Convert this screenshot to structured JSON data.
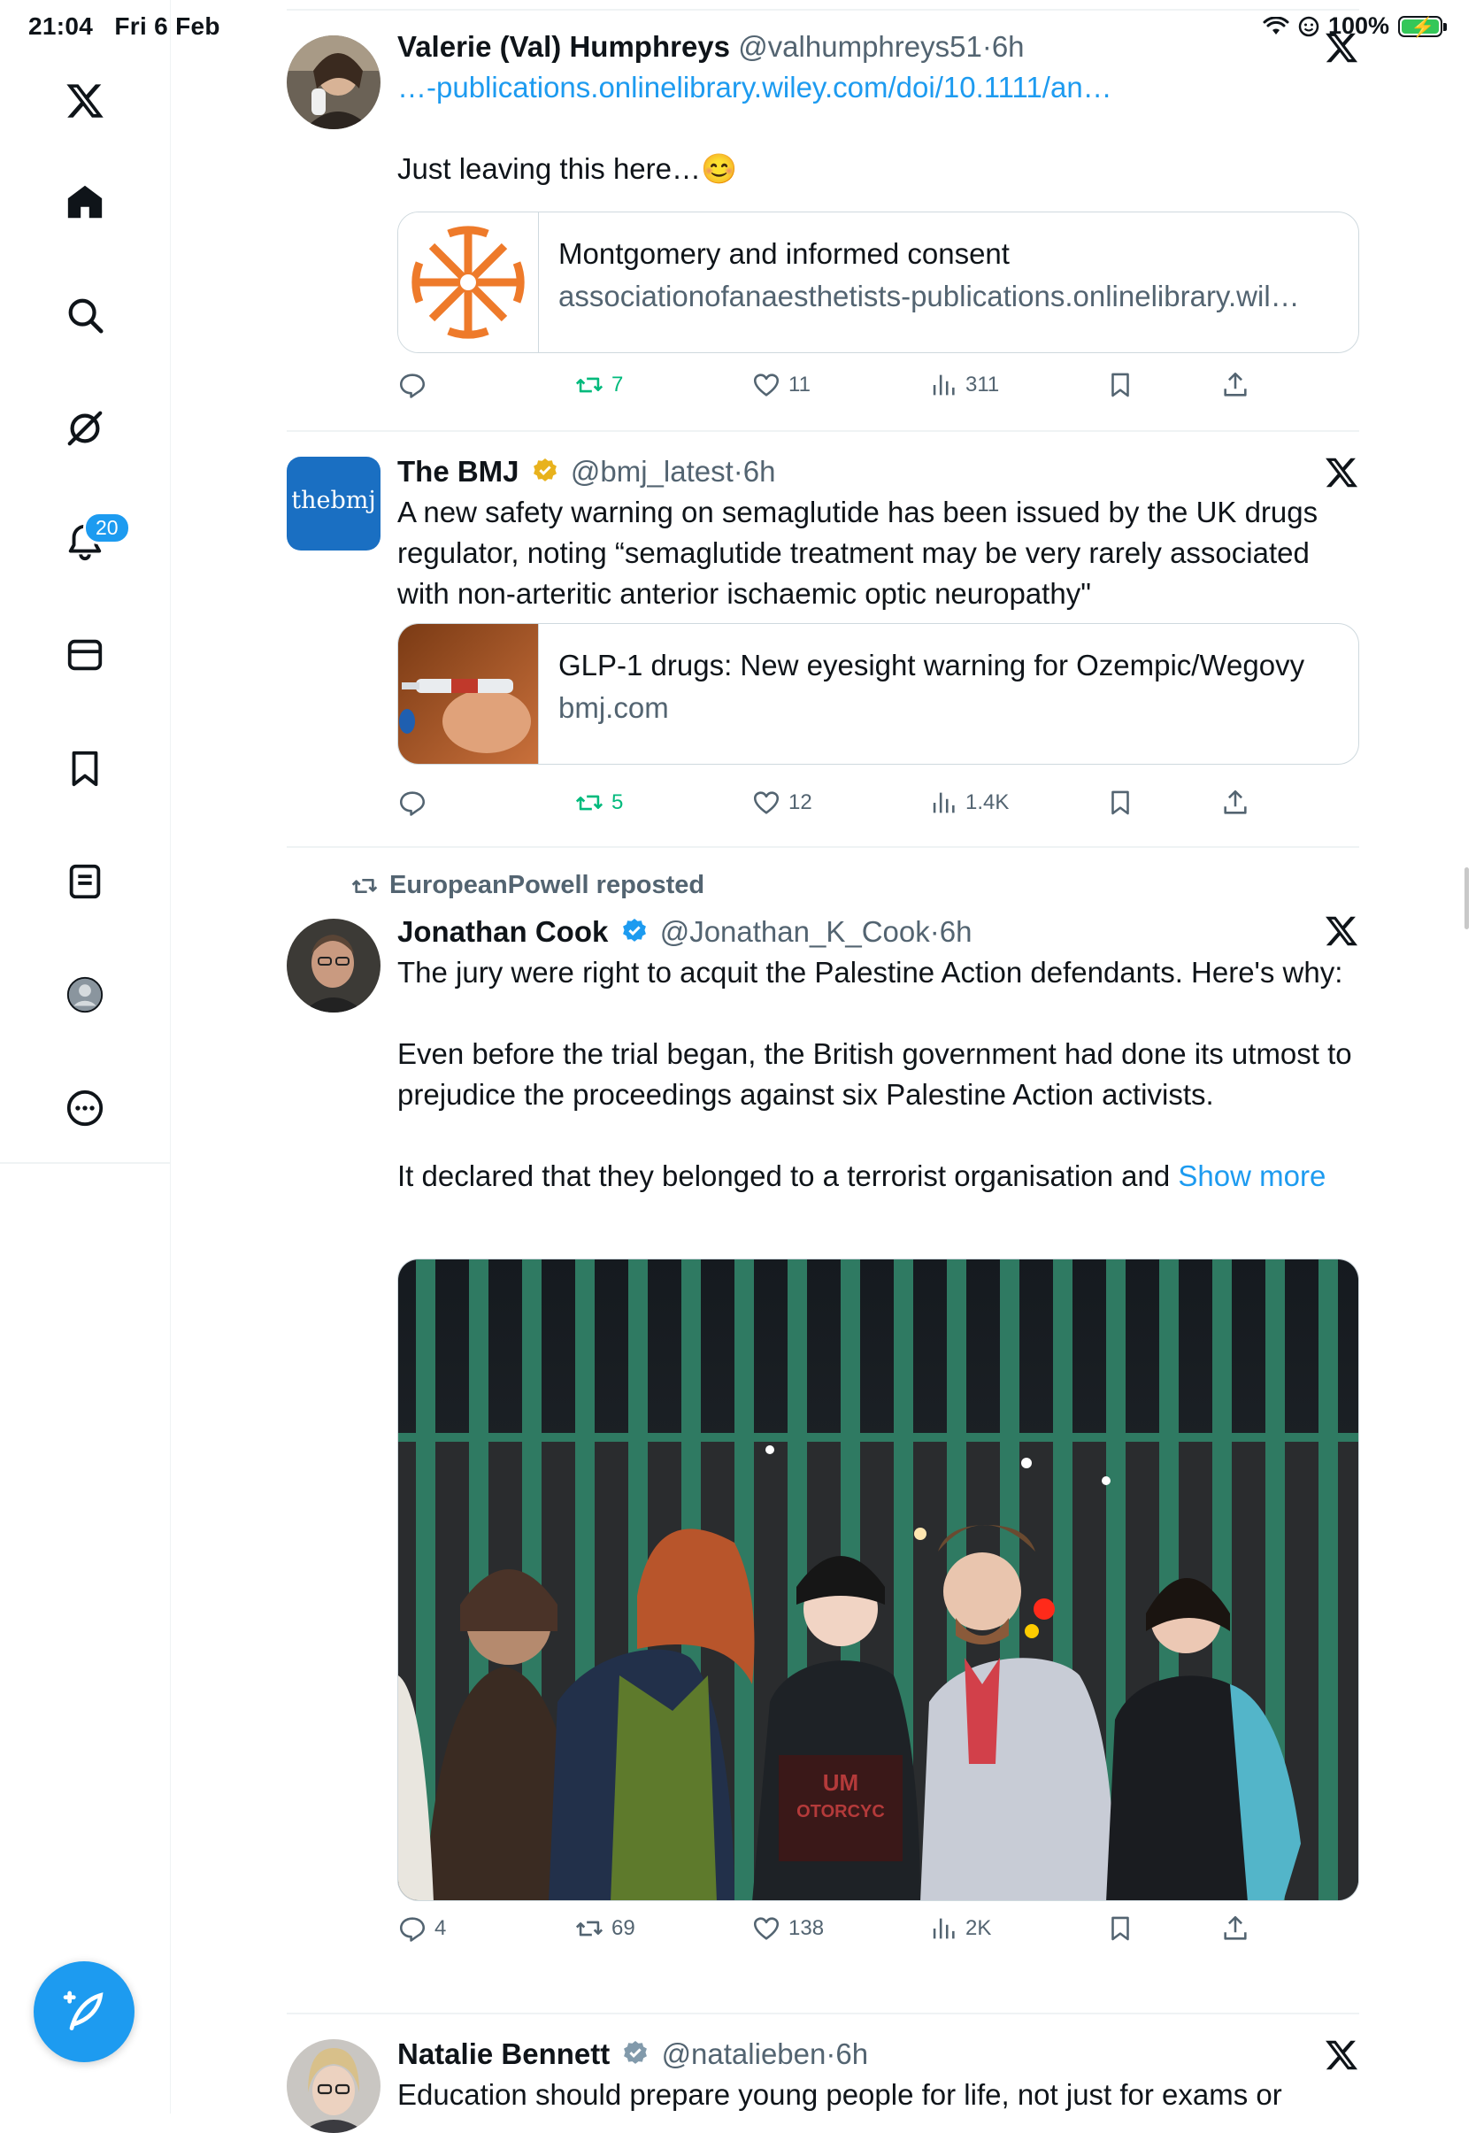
{
  "status_bar": {
    "time": "21:04",
    "date": "Fri 6 Feb",
    "battery": "100%"
  },
  "sidebar": {
    "items": [
      {
        "name": "x-logo-icon"
      },
      {
        "name": "home-icon"
      },
      {
        "name": "search-icon"
      },
      {
        "name": "grok-icon"
      },
      {
        "name": "notifications-icon",
        "badge": "20"
      },
      {
        "name": "messages-icon"
      },
      {
        "name": "bookmarks-icon"
      },
      {
        "name": "lists-icon"
      },
      {
        "name": "profile-icon"
      },
      {
        "name": "more-icon"
      }
    ],
    "compose": "compose-post-icon"
  },
  "tweets": [
    {
      "display_name": "Valerie (Val) Humphreys",
      "handle": "@valhumphreys51",
      "time": "6h",
      "link_text": "…-publications.onlinelibrary.wiley.com/doi/10.1111/an…",
      "text": "Just leaving this here…😊",
      "card": {
        "title": "Montgomery and informed consent",
        "domain": "associationofanaesthetists-publications.onlinelibrary.wil…"
      },
      "stats": {
        "replies": "",
        "reposts": "7",
        "likes": "11",
        "views": "311"
      }
    },
    {
      "display_name": "The BMJ",
      "handle": "@bmj_latest",
      "time": "6h",
      "avatar_text": "thebmj",
      "text": "A new safety warning on semaglutide has been issued by the UK drugs regulator, noting “semaglutide treatment may be very rarely associated with non-arteritic anterior ischaemic optic neuropathy\"",
      "card": {
        "title": "GLP-1 drugs: New eyesight warning for Ozempic/Wegovy",
        "domain": "bmj.com"
      },
      "stats": {
        "replies": "",
        "reposts": "5",
        "likes": "12",
        "views": "1.4K"
      }
    },
    {
      "repost_by": "EuropeanPowell reposted",
      "display_name": "Jonathan Cook",
      "handle": "@Jonathan_K_Cook",
      "time": "6h",
      "text": "The jury were right to acquit the Palestine Action defendants. Here's why:\n\nEven before the trial began, the British government had done its utmost to prejudice the proceedings against six Palestine Action activists.\n\nIt declared that they belonged to a terrorist organisation and ",
      "show_more": "Show more",
      "media_overlay": [
        "UM",
        "OTORCYC"
      ],
      "stats": {
        "replies": "4",
        "reposts": "69",
        "likes": "138",
        "views": "2K"
      }
    },
    {
      "display_name": "Natalie Bennett",
      "handle": "@natalieben",
      "time": "6h",
      "text": "Education should prepare young people for life, not just for exams or"
    }
  ],
  "colors": {
    "accent": "#1d9bf0",
    "repost_green": "#00ba7c",
    "muted": "#536471",
    "gold_verified": "#e8b21d"
  }
}
